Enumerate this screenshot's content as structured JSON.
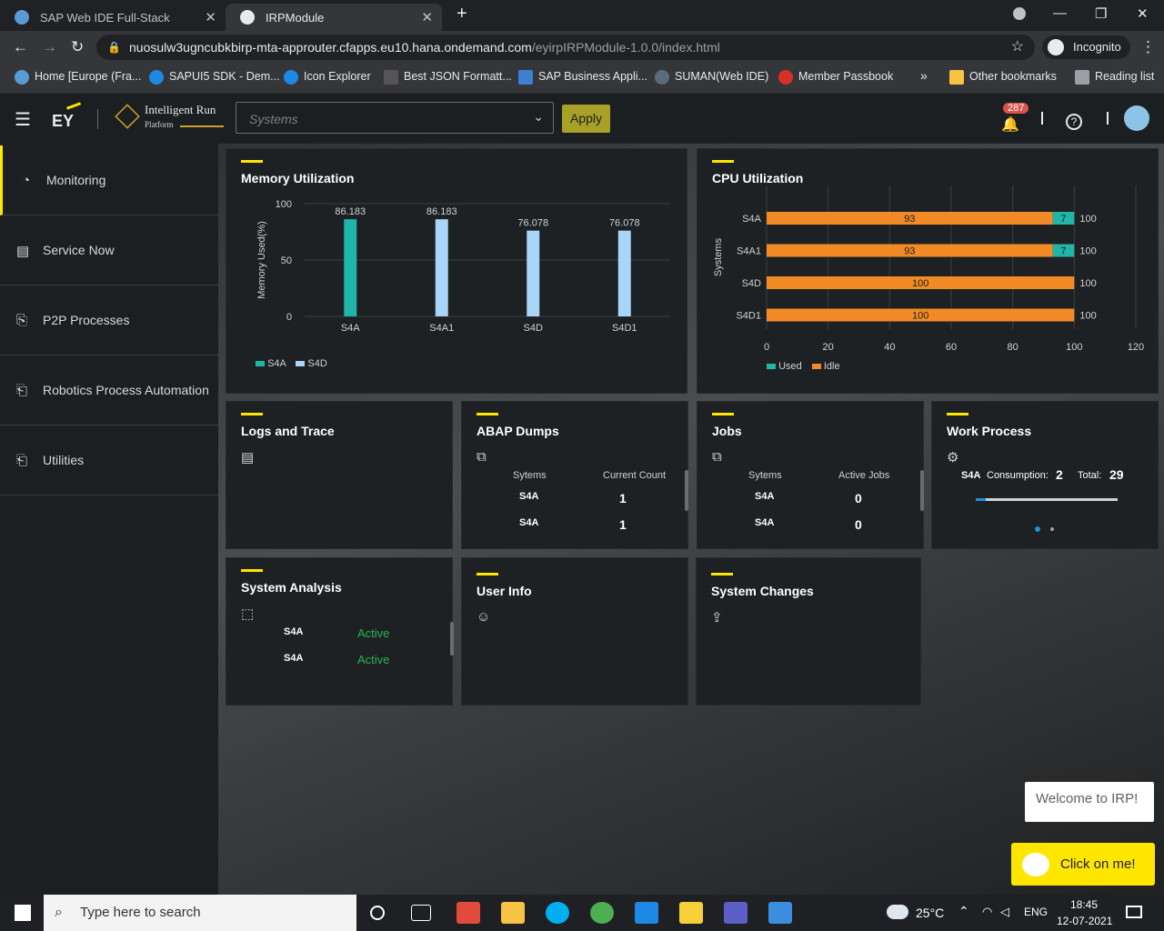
{
  "browser": {
    "tabs": [
      {
        "label": "SAP Web IDE Full-Stack",
        "active": false
      },
      {
        "label": "IRPModule",
        "active": true
      }
    ],
    "url_main": "nuosulw3ugncubkbirp-mta-approuter.cfapps.eu10.hana.ondemand.com",
    "url_path": "/eyirpIRPModule-1.0.0/index.html",
    "profile": "Incognito",
    "bookmarks": [
      "Home [Europe (Fra...",
      "SAPUI5 SDK - Dem...",
      "Icon Explorer",
      "Best JSON Formatt...",
      "SAP Business Appli...",
      "SUMAN(Web IDE)",
      "Member Passbook"
    ],
    "more_bookmarks": "»",
    "other_bookmarks": "Other bookmarks",
    "reading_list": "Reading list"
  },
  "header": {
    "logo": "EY",
    "brand_title": "Intelligent Run",
    "brand_sub": "Platform",
    "systems_placeholder": "Systems",
    "apply_label": "Apply",
    "notification_count": "287"
  },
  "sidebar": {
    "items": [
      {
        "label": "Monitoring",
        "icon": "gauge-icon",
        "active": true
      },
      {
        "label": "Service Now",
        "icon": "clipboard-icon",
        "active": false
      },
      {
        "label": "P2P Processes",
        "icon": "document-flow-icon",
        "active": false
      },
      {
        "label": "Robotics Process Automation",
        "icon": "robot-doc-icon",
        "active": false
      },
      {
        "label": "Utilities",
        "icon": "tools-icon",
        "active": false
      }
    ]
  },
  "memory_card": {
    "title": "Memory Utilization",
    "legend": [
      "S4A",
      "S4D"
    ]
  },
  "cpu_card": {
    "title": "CPU Utilization",
    "legend": [
      "Used",
      "Idle"
    ]
  },
  "logs_card": {
    "title": "Logs and Trace"
  },
  "abap_card": {
    "title": "ABAP Dumps",
    "col1": "Sytems",
    "col2": "Current Count",
    "rows": [
      {
        "sys": "S4A",
        "count": "1"
      },
      {
        "sys": "S4A",
        "count": "1"
      }
    ]
  },
  "jobs_card": {
    "title": "Jobs",
    "col1": "Sytems",
    "col2": "Active Jobs",
    "rows": [
      {
        "sys": "S4A",
        "count": "0"
      },
      {
        "sys": "S4A",
        "count": "0"
      }
    ]
  },
  "workprocess_card": {
    "title": "Work Process",
    "system": "S4A",
    "consumption_label": "Consumption:",
    "consumption_value": "2",
    "total_label": "Total:",
    "total_value": "29",
    "progress": 0.069
  },
  "analysis_card": {
    "title": "System Analysis",
    "rows": [
      {
        "sys": "S4A",
        "status": "Active"
      },
      {
        "sys": "S4A",
        "status": "Active"
      }
    ]
  },
  "userinfo_card": {
    "title": "User Info"
  },
  "changes_card": {
    "title": "System Changes"
  },
  "assistant": {
    "welcome": "Welcome to IRP!",
    "cta": "Click on me!"
  },
  "taskbar": {
    "search_placeholder": "Type here to search",
    "temperature": "25°C",
    "language": "ENG",
    "time": "18:45",
    "date": "12-07-2021"
  },
  "colors": {
    "accent": "#ffe600",
    "teal": "#1fb5a8",
    "lightblue": "#a8d5f8",
    "orange": "#f28b25",
    "active_green": "#2bb24c"
  },
  "chart_data": [
    {
      "type": "bar",
      "title": "Memory Utilization",
      "ylabel": "Memory Used(%)",
      "categories": [
        "S4A",
        "S4A1",
        "S4D",
        "S4D1"
      ],
      "values": [
        86.183,
        86.183,
        76.078,
        76.078
      ],
      "value_labels": [
        "86.183",
        "86.183",
        "76.078",
        "76.078"
      ],
      "series_legend": [
        "S4A",
        "S4D"
      ],
      "ylim": [
        0,
        100
      ],
      "yticks": [
        "0",
        "50",
        "100"
      ],
      "grid": true
    },
    {
      "type": "bar",
      "orientation": "horizontal",
      "stacked": true,
      "title": "CPU Utilization",
      "ylabel": "Systems",
      "categories": [
        "S4A",
        "S4A1",
        "S4D",
        "S4D1"
      ],
      "series": [
        {
          "name": "Idle",
          "values": [
            93,
            93,
            100,
            100
          ]
        },
        {
          "name": "Used",
          "values": [
            7,
            7,
            0,
            0
          ]
        }
      ],
      "totals": [
        "100",
        "100",
        "100",
        "100"
      ],
      "xlim": [
        0,
        120
      ],
      "xticks": [
        "0",
        "20",
        "40",
        "60",
        "80",
        "100",
        "120"
      ],
      "legend": "bottom-left",
      "grid": true
    }
  ]
}
